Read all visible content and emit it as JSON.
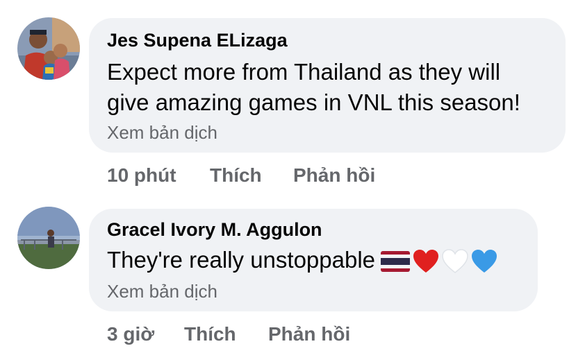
{
  "comments": [
    {
      "author": "Jes Supena ELizaga",
      "text_line1": "Expect more from Thailand as they will",
      "text_line2": "give amazing games in VNL this season!",
      "translate_label": "Xem bản dịch",
      "time": "10 phút",
      "like_label": "Thích",
      "reply_label": "Phản hồi"
    },
    {
      "author": "Gracel Ivory M. Aggulon",
      "text": "They're really unstoppable",
      "emojis": [
        "thailand-flag-icon",
        "red-heart-icon",
        "white-heart-icon",
        "blue-heart-icon"
      ],
      "translate_label": "Xem bản dịch",
      "time": "3 giờ",
      "like_label": "Thích",
      "reply_label": "Phản hồi"
    }
  ],
  "colors": {
    "bubble": "#f0f2f5",
    "secondary_text": "#65676b",
    "primary_text": "#050505"
  }
}
